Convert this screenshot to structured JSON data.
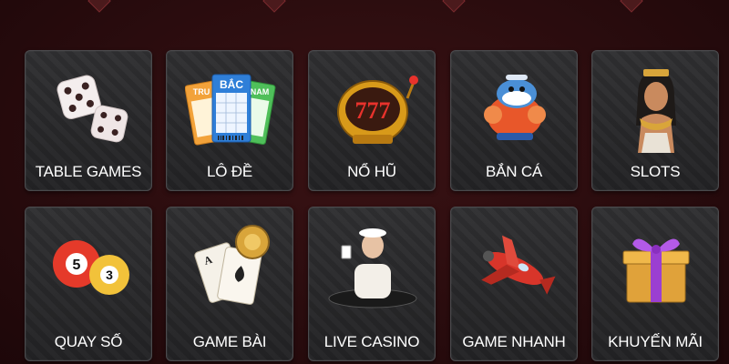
{
  "categories": [
    {
      "label": "TABLE GAMES",
      "icon": "dice-icon"
    },
    {
      "label": "LÔ ĐỀ",
      "icon": "lottery-tickets-icon"
    },
    {
      "label": "NỔ HŨ",
      "icon": "slot-jackpot-777-icon"
    },
    {
      "label": "BẮN CÁ",
      "icon": "fish-shooter-icon"
    },
    {
      "label": "SLOTS",
      "icon": "cleopatra-icon"
    },
    {
      "label": "QUAY SỐ",
      "icon": "lottery-balls-icon"
    },
    {
      "label": "GAME BÀI",
      "icon": "playing-cards-chip-icon"
    },
    {
      "label": "LIVE CASINO",
      "icon": "live-dealer-icon"
    },
    {
      "label": "GAME NHANH",
      "icon": "airplane-icon"
    },
    {
      "label": "KHUYẾN MÃI",
      "icon": "gift-box-icon"
    }
  ],
  "ticket_labels": [
    "TRU",
    "BẮC",
    "NAM"
  ],
  "slot_text": "777",
  "ball_numbers": [
    "5",
    "3"
  ],
  "colors": {
    "background": "#2a0c0e",
    "card": "#2a2a2c",
    "label": "#ffffff"
  }
}
